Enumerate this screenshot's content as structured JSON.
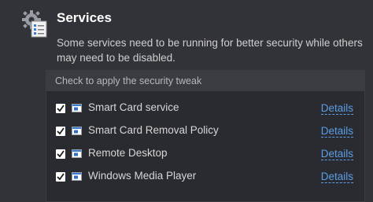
{
  "section": {
    "title": "Services",
    "icon": "gear-checklist-icon",
    "description": "Some services need to be running for better security while others may need to be disabled."
  },
  "list": {
    "header": "Check to apply the security tweak",
    "items": [
      {
        "label": "Smart Card service",
        "checked": true,
        "icon": "service-window-icon",
        "link": "Details"
      },
      {
        "label": "Smart Card Removal Policy",
        "checked": true,
        "icon": "service-window-icon",
        "link": "Details"
      },
      {
        "label": "Remote Desktop",
        "checked": true,
        "icon": "service-window-icon",
        "link": "Details"
      },
      {
        "label": "Windows Media Player",
        "checked": true,
        "icon": "service-window-icon",
        "link": "Details"
      }
    ]
  },
  "colors": {
    "background": "#323338",
    "list_background": "#2a2b30",
    "header_background": "#3b3c42",
    "link": "#5a9ee8"
  }
}
